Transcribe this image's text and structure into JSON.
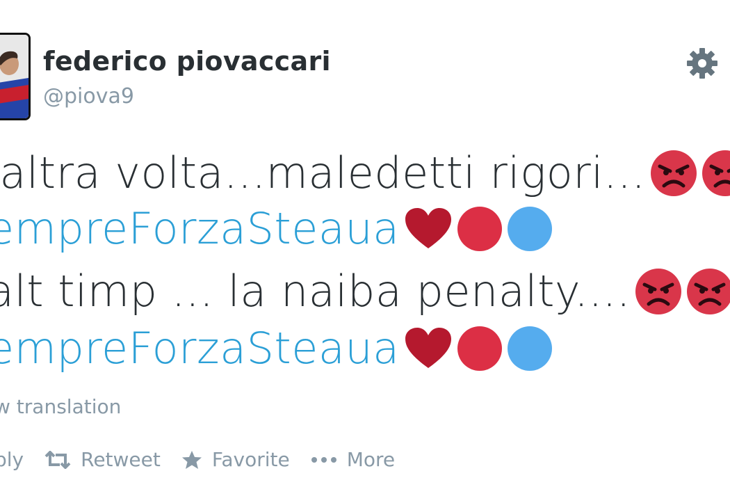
{
  "user": {
    "display_name": "federico piovaccari",
    "handle": "@piova9"
  },
  "tweet": {
    "line1_text": "'altra volta...maledetti rigori...",
    "line2_hashtag": "empreForzaSteaua",
    "line3_text": " alt timp ... la naiba penalty....",
    "line4_hashtag": "empreForzaSteaua"
  },
  "view_translation": "w translation",
  "actions": {
    "reply": "ply",
    "retweet": "Retweet",
    "favorite": "Favorite",
    "more": "More"
  },
  "icons": {
    "settings": "gear-icon",
    "angry_face": "angry-face-icon",
    "heart": "heart-icon",
    "red_circle": "red-circle-icon",
    "blue_circle": "blue-circle-icon"
  },
  "colors": {
    "link": "#2b9fd6",
    "muted": "#8899a6",
    "text": "#292f33",
    "angry": "#d9364a",
    "heart": "#b5192e",
    "red_circle": "#dc2f45",
    "blue_circle": "#55acee"
  }
}
